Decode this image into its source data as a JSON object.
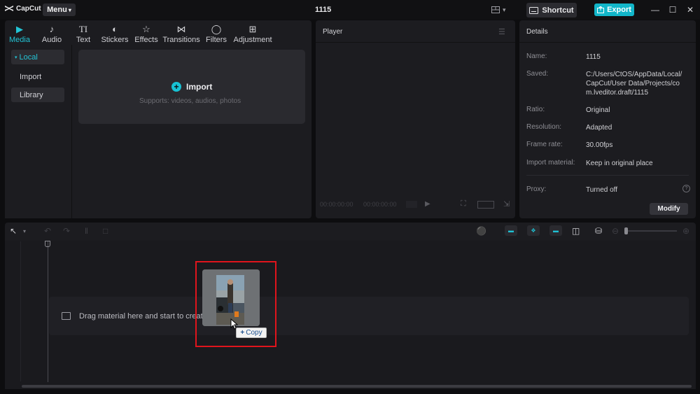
{
  "titlebar": {
    "app_name": "CapCut",
    "menu_label": "Menu",
    "project_title": "1115",
    "shortcut_label": "Shortcut",
    "export_label": "Export"
  },
  "media": {
    "tabs": [
      {
        "label": "Media",
        "icon": "media-icon",
        "active": true
      },
      {
        "label": "Audio",
        "icon": "audio-icon",
        "active": false
      },
      {
        "label": "Text",
        "icon": "text-icon",
        "active": false
      },
      {
        "label": "Stickers",
        "icon": "sticker-icon",
        "active": false
      },
      {
        "label": "Effects",
        "icon": "effects-icon",
        "active": false
      },
      {
        "label": "Transitions",
        "icon": "transitions-icon",
        "active": false
      },
      {
        "label": "Filters",
        "icon": "filters-icon",
        "active": false
      },
      {
        "label": "Adjustment",
        "icon": "adjustment-icon",
        "active": false
      }
    ],
    "sidebar": {
      "local": "Local",
      "import": "Import",
      "library": "Library"
    },
    "import_label": "Import",
    "import_sub": "Supports: videos, audios, photos"
  },
  "player": {
    "title": "Player",
    "timecode_current": "00:00:00:00",
    "timecode_duration": "00:00:00:00"
  },
  "details": {
    "title": "Details",
    "rows": [
      {
        "label": "Name:",
        "value": "1115"
      },
      {
        "label": "Saved:",
        "value": "C:/Users/CtOS/AppData/Local/CapCut/User Data/Projects/com.lveditor.draft/1115"
      },
      {
        "label": "Ratio:",
        "value": "Original"
      },
      {
        "label": "Resolution:",
        "value": "Adapted"
      },
      {
        "label": "Frame rate:",
        "value": "30.00fps"
      },
      {
        "label": "Import material:",
        "value": "Keep in original place"
      },
      {
        "label": "Proxy:",
        "value": "Turned off"
      }
    ],
    "modify_label": "Modify"
  },
  "timeline": {
    "drop_hint": "Drag material here and start to create",
    "copy_tooltip": "Copy"
  },
  "colors": {
    "accent": "#12b6c9",
    "highlight_box": "#e0141c"
  }
}
